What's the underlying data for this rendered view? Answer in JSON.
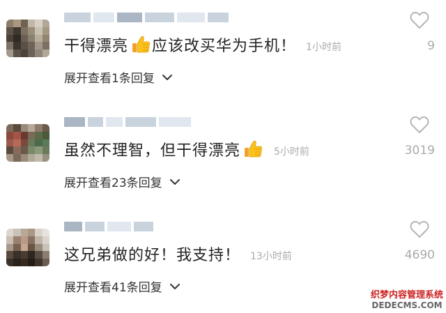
{
  "comments": [
    {
      "text_before_emoji": "干得漂亮",
      "text_after_emoji": "应该改买华为手机！",
      "has_thumb": true,
      "time": "1小时前",
      "likes": "9",
      "expand_label": "展开查看1条回复"
    },
    {
      "text_before_emoji": "虽然不理智，但干得漂亮",
      "text_after_emoji": "",
      "has_thumb": true,
      "time": "5小时前",
      "likes": "3019",
      "expand_label": "展开查看23条回复"
    },
    {
      "text_before_emoji": "这兄弟做的好！我支持！",
      "text_after_emoji": "",
      "has_thumb": false,
      "time": "13小时前",
      "likes": "4690",
      "expand_label": "展开查看41条回复"
    }
  ],
  "watermark": {
    "line1": "织梦内容管理系统",
    "line2": "DEDECMS.COM"
  },
  "icons": {
    "like": "heart-outline-icon",
    "expand": "chevron-down-icon",
    "emoji": "thumbs-up-emoji-icon"
  },
  "colors": {
    "text": "#222222",
    "muted": "#aaaaaa",
    "watermark": "#cc2222"
  }
}
